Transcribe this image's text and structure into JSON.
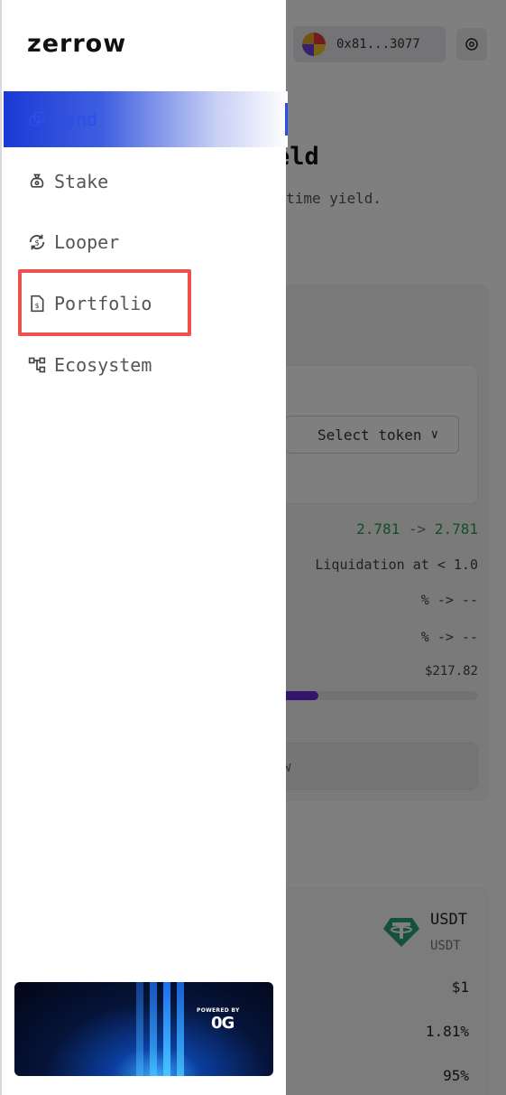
{
  "header": {
    "wallet_address": "0x81...3077"
  },
  "main": {
    "title": "n Yield",
    "subtitle": "rn real-time yield.",
    "select_token_label": "Select token",
    "health_from": "2.781",
    "health_arrow": "->",
    "health_to": "2.781",
    "liquidation_text": "Liquidation at < 1.0",
    "row1": "%  ->   --",
    "row2": "%  ->  --",
    "amount": "$217.82",
    "progress_fraction": 0.23,
    "button_label": "w"
  },
  "market": {
    "token_name": "USDT",
    "token_symbol": "USDT",
    "price": "$1",
    "apy": "1.81%",
    "ltv": "95%"
  },
  "sidebar": {
    "logo": "zerrow",
    "items": [
      {
        "label": "Lend",
        "icon": "lend-icon",
        "active": true
      },
      {
        "label": "Stake",
        "icon": "moneybag-icon",
        "active": false
      },
      {
        "label": "Looper",
        "icon": "loop-icon",
        "active": false
      },
      {
        "label": "Portfolio",
        "icon": "document-icon",
        "active": false
      },
      {
        "label": "Ecosystem",
        "icon": "network-icon",
        "active": false
      }
    ],
    "banner": {
      "powered_by": "POWERED BY",
      "brand": "0G"
    }
  },
  "colors": {
    "accent": "#2b4fe8",
    "highlight": "#f04f4f",
    "positive": "#2a9d49",
    "progress": "#6a2ad6"
  }
}
